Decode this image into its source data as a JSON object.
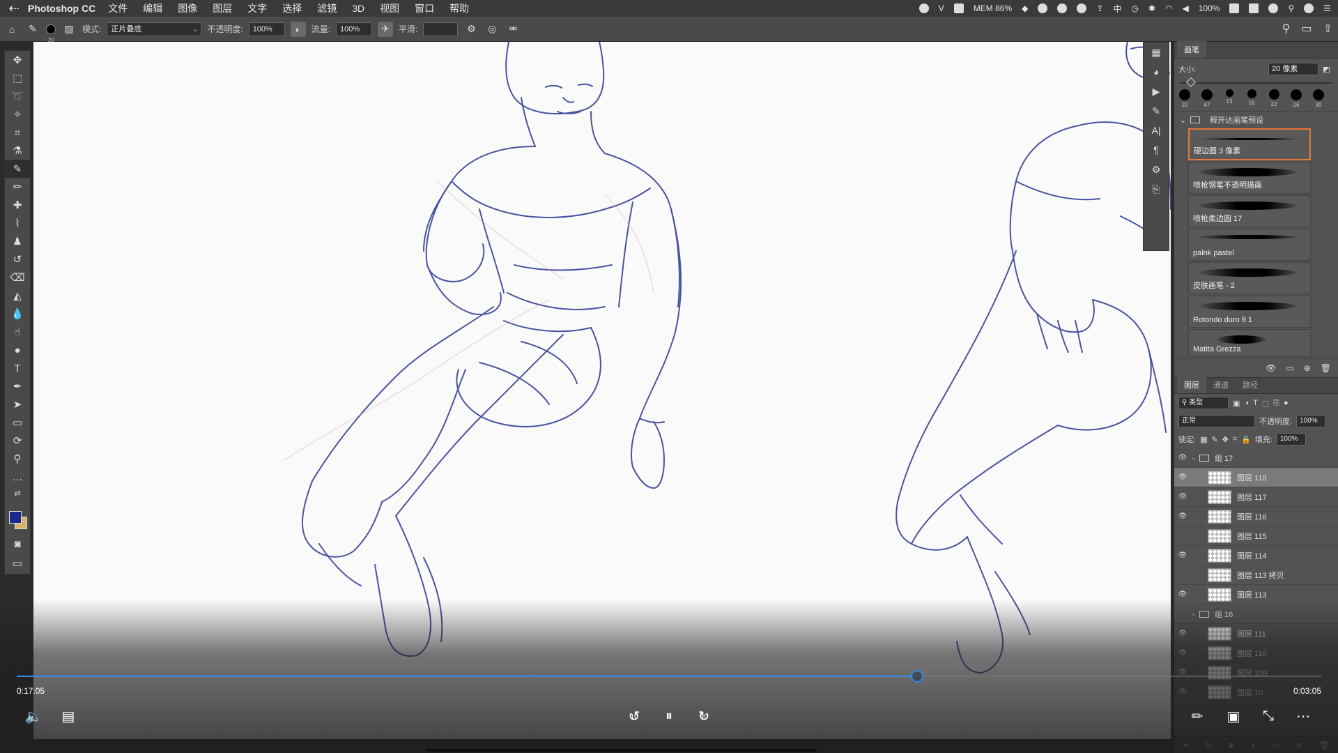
{
  "menubar": {
    "app_name": "Photoshop CC",
    "items": [
      "文件",
      "编辑",
      "图像",
      "图层",
      "文字",
      "选择",
      "滤镜",
      "3D",
      "视图",
      "窗口",
      "帮助"
    ],
    "status": {
      "mem": "MEM 86%",
      "ime": "中",
      "battery": "100%"
    }
  },
  "options": {
    "brush_size": "20",
    "mode_label": "模式:",
    "mode_value": "正片叠底",
    "opacity_label": "不透明度:",
    "opacity_value": "100%",
    "flow_label": "流量:",
    "flow_value": "100%",
    "smooth_label": "平滑:",
    "smooth_value": ""
  },
  "brush_panel": {
    "tab": "画笔",
    "size_label": "大小:",
    "size_value": "20 像素",
    "size_fraction": 0.05,
    "preset_sizes": [
      "20",
      "47",
      "13",
      "16",
      "22",
      "26",
      "30"
    ],
    "folder_name": "释开达画笔预设",
    "brushes": [
      {
        "label": "硬边圆 3 像素"
      },
      {
        "label": "喷枪钢笔不透明描画"
      },
      {
        "label": "喷枪柔边圆 17"
      },
      {
        "label": "palnk pastel"
      },
      {
        "label": "皮肤画笔 - 2"
      },
      {
        "label": "Rotondo duro 9 1"
      },
      {
        "label": "Matita Grezza"
      }
    ]
  },
  "layers_panel": {
    "tabs": [
      "图层",
      "通道",
      "路径"
    ],
    "filter_label": "类型",
    "blend_mode": "正常",
    "opacity_label": "不透明度:",
    "opacity_value": "100%",
    "lock_label": "锁定:",
    "fill_label": "填充:",
    "fill_value": "100%",
    "layers": [
      {
        "name": "组 17",
        "type": "group",
        "visible": true,
        "expanded": true
      },
      {
        "name": "图层 118",
        "type": "layer",
        "visible": true,
        "selected": true
      },
      {
        "name": "图层 117",
        "type": "layer",
        "visible": true
      },
      {
        "name": "图层 116",
        "type": "layer",
        "visible": true
      },
      {
        "name": "图层 115",
        "type": "layer",
        "visible": false
      },
      {
        "name": "图层 114",
        "type": "layer",
        "visible": true
      },
      {
        "name": "图层 113 拷贝",
        "type": "layer",
        "visible": false
      },
      {
        "name": "图层 113",
        "type": "layer",
        "visible": true
      },
      {
        "name": "组 16",
        "type": "group",
        "visible": false,
        "expanded": true
      },
      {
        "name": "图层 111",
        "type": "layer",
        "visible": true
      },
      {
        "name": "图层 110",
        "type": "layer",
        "visible": true
      },
      {
        "name": "图层 109",
        "type": "layer",
        "visible": true
      },
      {
        "name": "图层 10",
        "type": "layer",
        "visible": true
      }
    ]
  },
  "video": {
    "elapsed": "0:17:05",
    "remaining": "0:03:05",
    "progress": 0.69,
    "skip_back": "10",
    "skip_forward": "30"
  },
  "colors": {
    "foreground": "#1a2a8c",
    "background": "#d7b46d",
    "accent": "#2f8ce8",
    "sketch": "#2b3691"
  }
}
